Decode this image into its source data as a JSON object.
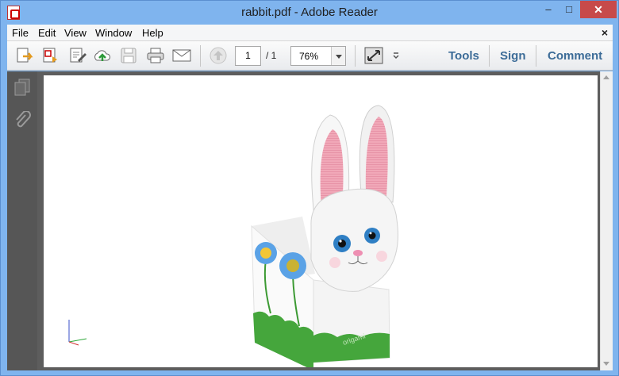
{
  "window": {
    "title": "rabbit.pdf - Adobe Reader",
    "controls": {
      "minimize": "‒",
      "maximize": "□",
      "close": "✕"
    }
  },
  "menubar": {
    "items": [
      {
        "label": "File"
      },
      {
        "label": "Edit"
      },
      {
        "label": "View"
      },
      {
        "label": "Window"
      },
      {
        "label": "Help"
      }
    ],
    "close_label": "×"
  },
  "toolbar": {
    "icons": [
      "open-icon",
      "create-pdf-icon",
      "edit-icon",
      "upload-icon",
      "save-icon",
      "print-icon",
      "email-icon",
      "prev-page-icon",
      "fit-icon",
      "more-icon"
    ],
    "page_current": "1",
    "page_total": "/ 1",
    "zoom": "76%",
    "links": {
      "tools": "Tools",
      "sign": "Sign",
      "comment": "Comment"
    }
  },
  "sidebar": {
    "icons": [
      "pages-icon",
      "attachments-icon"
    ]
  },
  "document": {
    "brand_text": "origami"
  },
  "colors": {
    "titlebar": "#7fb4ee",
    "close_button": "#c74a4a",
    "link_text": "#3c6c98",
    "sidebar": "#565656",
    "doc_background": "#5d5d5d"
  }
}
